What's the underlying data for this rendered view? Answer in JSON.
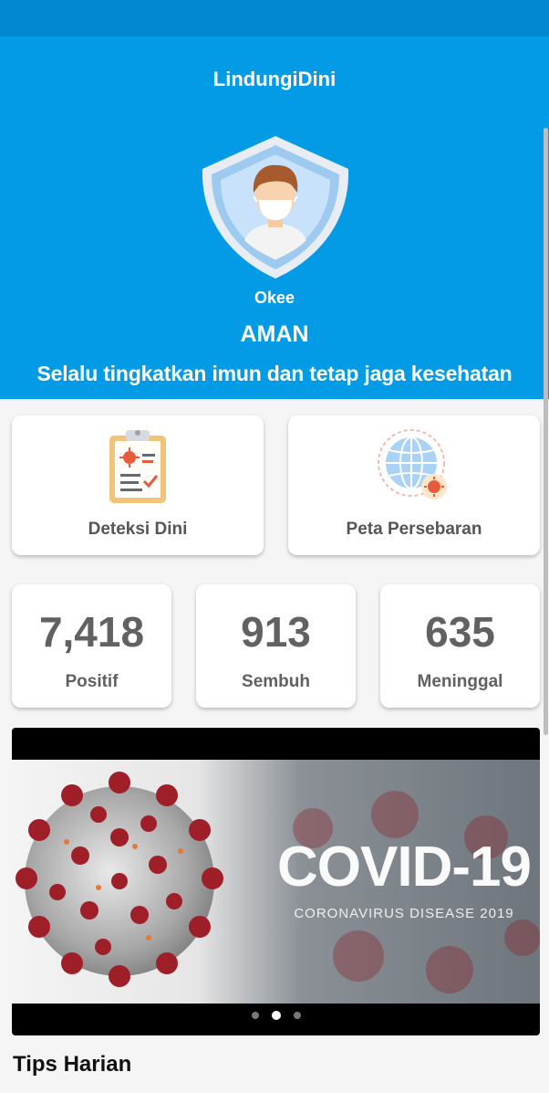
{
  "app": {
    "title": "LindungiDini"
  },
  "profile": {
    "name": "Okee",
    "status": "AMAN",
    "message": "Selalu tingkatkan imun dan tetap jaga kesehatan"
  },
  "menu": [
    {
      "label": "Deteksi Dini",
      "icon": "clipboard-virus-icon"
    },
    {
      "label": "Peta Persebaran",
      "icon": "globe-virus-icon"
    }
  ],
  "stats": [
    {
      "value": "7,418",
      "label": "Positif"
    },
    {
      "value": "913",
      "label": "Sembuh"
    },
    {
      "value": "635",
      "label": "Meninggal"
    }
  ],
  "banner": {
    "title": "COVID-19",
    "subtitle": "CORONAVIRUS DISEASE 2019",
    "slide_count": 3,
    "active_slide": 2
  },
  "tips": {
    "title": "Tips Harian"
  },
  "colors": {
    "header": "#039be5",
    "status_bar": "#0288d1",
    "stat_text": "#616161"
  }
}
